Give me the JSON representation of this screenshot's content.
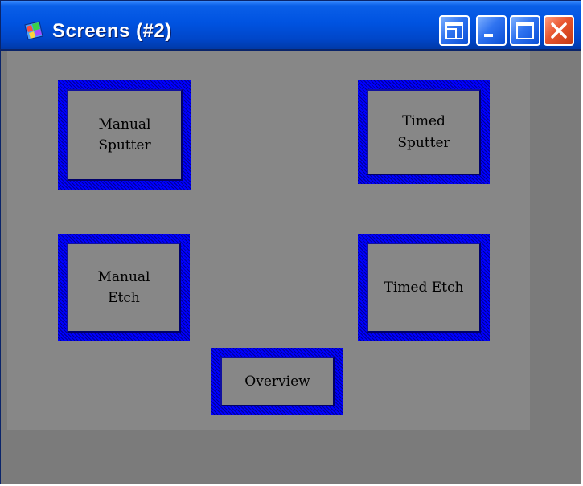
{
  "window": {
    "title": "Screens (#2)"
  },
  "titlebar_buttons": {
    "restore_icon": "window-restore-icon",
    "minimize_icon": "minimize-icon",
    "maximize_icon": "maximize-icon",
    "close_icon": "close-icon"
  },
  "screens": [
    {
      "label": "Manual\nSputter"
    },
    {
      "label": "Timed\nSputter"
    },
    {
      "label": "Manual\nEtch"
    },
    {
      "label": "Timed Etch"
    },
    {
      "label": "Overview"
    }
  ],
  "colors": {
    "button_frame": "#0000ff",
    "client_background": "#878787",
    "titlebar": "#0053e1"
  }
}
